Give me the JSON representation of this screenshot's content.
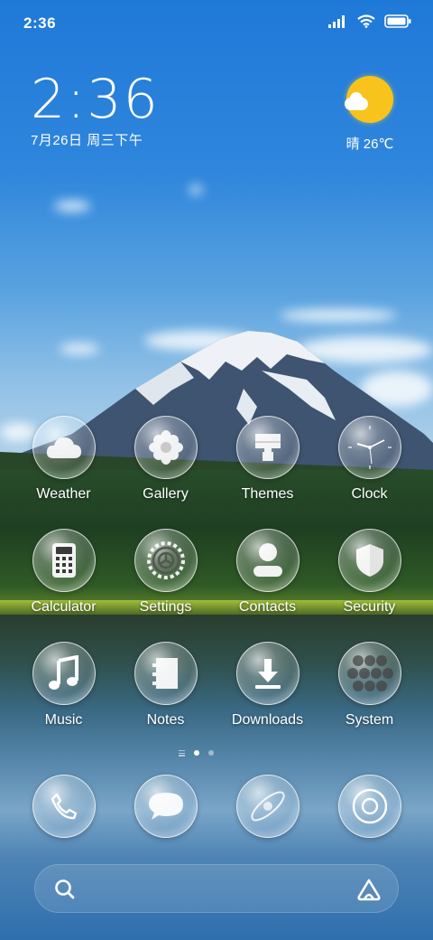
{
  "status_bar": {
    "time": "2:36"
  },
  "clock_widget": {
    "time": "2:36",
    "date": "7月26日 周三下午"
  },
  "weather_widget": {
    "text": "晴 26℃"
  },
  "apps": [
    {
      "label": "Weather",
      "icon": "weather-icon"
    },
    {
      "label": "Gallery",
      "icon": "gallery-icon"
    },
    {
      "label": "Themes",
      "icon": "themes-icon"
    },
    {
      "label": "Clock",
      "icon": "clock-icon"
    },
    {
      "label": "Calculator",
      "icon": "calculator-icon"
    },
    {
      "label": "Settings",
      "icon": "settings-icon"
    },
    {
      "label": "Contacts",
      "icon": "contacts-icon"
    },
    {
      "label": "Security",
      "icon": "security-icon"
    },
    {
      "label": "Music",
      "icon": "music-icon"
    },
    {
      "label": "Notes",
      "icon": "notes-icon"
    },
    {
      "label": "Downloads",
      "icon": "downloads-icon"
    },
    {
      "label": "System",
      "icon": "system-folder-icon"
    }
  ],
  "dock": [
    {
      "icon": "phone-icon"
    },
    {
      "icon": "messages-icon"
    },
    {
      "icon": "browser-icon"
    },
    {
      "icon": "camera-icon"
    }
  ],
  "page_indicator": {
    "pages": 2,
    "current": 1
  },
  "search_bar": {
    "left_icon": "search-icon",
    "right_icon": "assistant-icon"
  }
}
